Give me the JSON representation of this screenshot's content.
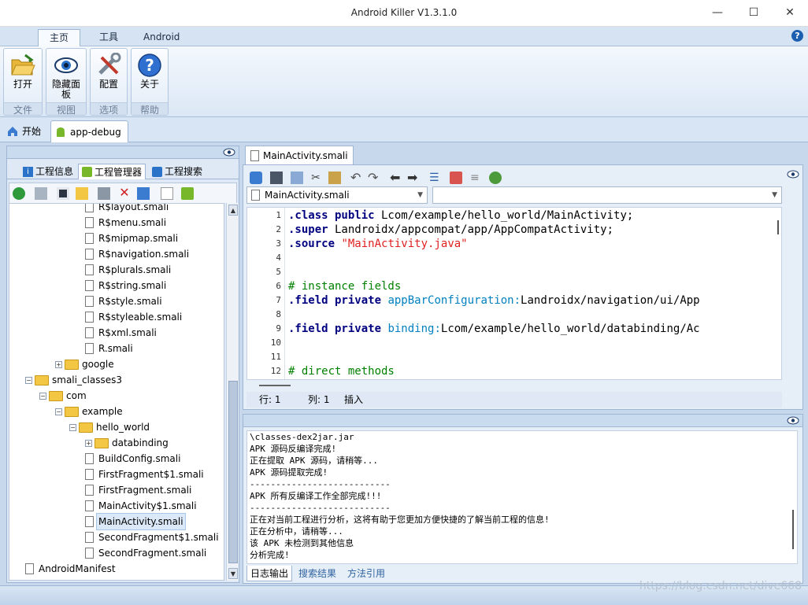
{
  "window": {
    "title": "Android Killer V1.3.1.0",
    "minimize": "—",
    "maximize": "☐",
    "close": "✕"
  },
  "ribbon_tabs": [
    "主页",
    "工具",
    "Android"
  ],
  "help_glyph": "?",
  "ribbon_groups": [
    {
      "button": "打开",
      "group": "文件",
      "icon": "folder-open-icon"
    },
    {
      "button": "隐藏面板",
      "group": "视图",
      "icon": "eye-icon"
    },
    {
      "button": "配置",
      "group": "选项",
      "icon": "tools-icon"
    },
    {
      "button": "关于",
      "group": "帮助",
      "icon": "question-icon"
    }
  ],
  "doc_tabs": [
    {
      "label": "开始",
      "icon": "home-icon"
    },
    {
      "label": "app-debug",
      "icon": "android-icon"
    }
  ],
  "left_tabs": [
    {
      "label": "工程信息",
      "icon": "info-icon"
    },
    {
      "label": "工程管理器",
      "icon": "android-project-icon"
    },
    {
      "label": "工程搜索",
      "icon": "search-icon"
    }
  ],
  "tree": [
    {
      "label": "R$layout.smali",
      "kind": "file"
    },
    {
      "label": "R$menu.smali",
      "kind": "file"
    },
    {
      "label": "R$mipmap.smali",
      "kind": "file"
    },
    {
      "label": "R$navigation.smali",
      "kind": "file"
    },
    {
      "label": "R$plurals.smali",
      "kind": "file"
    },
    {
      "label": "R$string.smali",
      "kind": "file"
    },
    {
      "label": "R$style.smali",
      "kind": "file"
    },
    {
      "label": "R$styleable.smali",
      "kind": "file"
    },
    {
      "label": "R$xml.smali",
      "kind": "file"
    },
    {
      "label": "R.smali",
      "kind": "file"
    },
    {
      "label": "google",
      "kind": "folder",
      "expander": "+"
    },
    {
      "label": "smali_classes3",
      "kind": "folder",
      "expander": "−"
    },
    {
      "label": "com",
      "kind": "folder",
      "expander": "−"
    },
    {
      "label": "example",
      "kind": "folder",
      "expander": "−"
    },
    {
      "label": "hello_world",
      "kind": "folder",
      "expander": "−"
    },
    {
      "label": "databinding",
      "kind": "folder",
      "expander": "+"
    },
    {
      "label": "BuildConfig.smali",
      "kind": "file"
    },
    {
      "label": "FirstFragment$1.smali",
      "kind": "file"
    },
    {
      "label": "FirstFragment.smali",
      "kind": "file"
    },
    {
      "label": "MainActivity$1.smali",
      "kind": "file"
    },
    {
      "label": "MainActivity.smali",
      "kind": "file",
      "selected": true
    },
    {
      "label": "SecondFragment$1.smali",
      "kind": "file"
    },
    {
      "label": "SecondFragment.smali",
      "kind": "file"
    },
    {
      "label": "AndroidManifest",
      "kind": "file"
    }
  ],
  "editor": {
    "tab_label": "MainActivity.smali",
    "file_select": "MainActivity.smali",
    "method_select": "",
    "lines": [
      {
        "n": "1",
        "parts": [
          [
            ".class public",
            "kw"
          ],
          [
            " Lcom/example/hello_world/MainActivity;",
            "pl"
          ]
        ]
      },
      {
        "n": "2",
        "parts": [
          [
            ".super",
            "kw"
          ],
          [
            " Landroidx/appcompat/app/AppCompatActivity;",
            "pl"
          ]
        ]
      },
      {
        "n": "3",
        "parts": [
          [
            ".source",
            "kw"
          ],
          [
            " ",
            "pl"
          ],
          [
            "\"MainActivity.java\"",
            "st"
          ]
        ]
      },
      {
        "n": "4",
        "parts": []
      },
      {
        "n": "5",
        "parts": []
      },
      {
        "n": "6",
        "parts": [
          [
            "# instance fields",
            "cm"
          ]
        ]
      },
      {
        "n": "7",
        "parts": [
          [
            ".field private",
            "kw"
          ],
          [
            " ",
            "pl"
          ],
          [
            "appBarConfiguration:",
            "ty"
          ],
          [
            "Landroidx/navigation/ui/App",
            "pl"
          ]
        ]
      },
      {
        "n": "8",
        "parts": []
      },
      {
        "n": "9",
        "parts": [
          [
            ".field private",
            "kw"
          ],
          [
            " ",
            "pl"
          ],
          [
            "binding:",
            "ty"
          ],
          [
            "Lcom/example/hello_world/databinding/Ac",
            "pl"
          ]
        ]
      },
      {
        "n": "10",
        "parts": []
      },
      {
        "n": "11",
        "parts": []
      },
      {
        "n": "12",
        "parts": [
          [
            "# direct methods",
            "cm"
          ]
        ]
      }
    ],
    "status": {
      "row": "行: 1",
      "col": "列: 1",
      "mode": "插入"
    }
  },
  "log": {
    "lines": [
      "\\classes-dex2jar.jar",
      "APK 源码反编译完成!",
      "正在提取 APK 源码，请稍等...",
      "APK 源码提取完成!",
      "---------------------------",
      "APK 所有反编译工作全部完成!!!",
      "---------------------------",
      "正在对当前工程进行分析，这将有助于您更加方便快捷的了解当前工程的信息!",
      "正在分析中，请稍等...",
      "该 APK 未检测到其他信息",
      "分析完成!"
    ],
    "tabs": [
      "日志输出",
      "搜索结果",
      "方法引用"
    ]
  },
  "watermark": "https://blog.csdn.net/dive668"
}
